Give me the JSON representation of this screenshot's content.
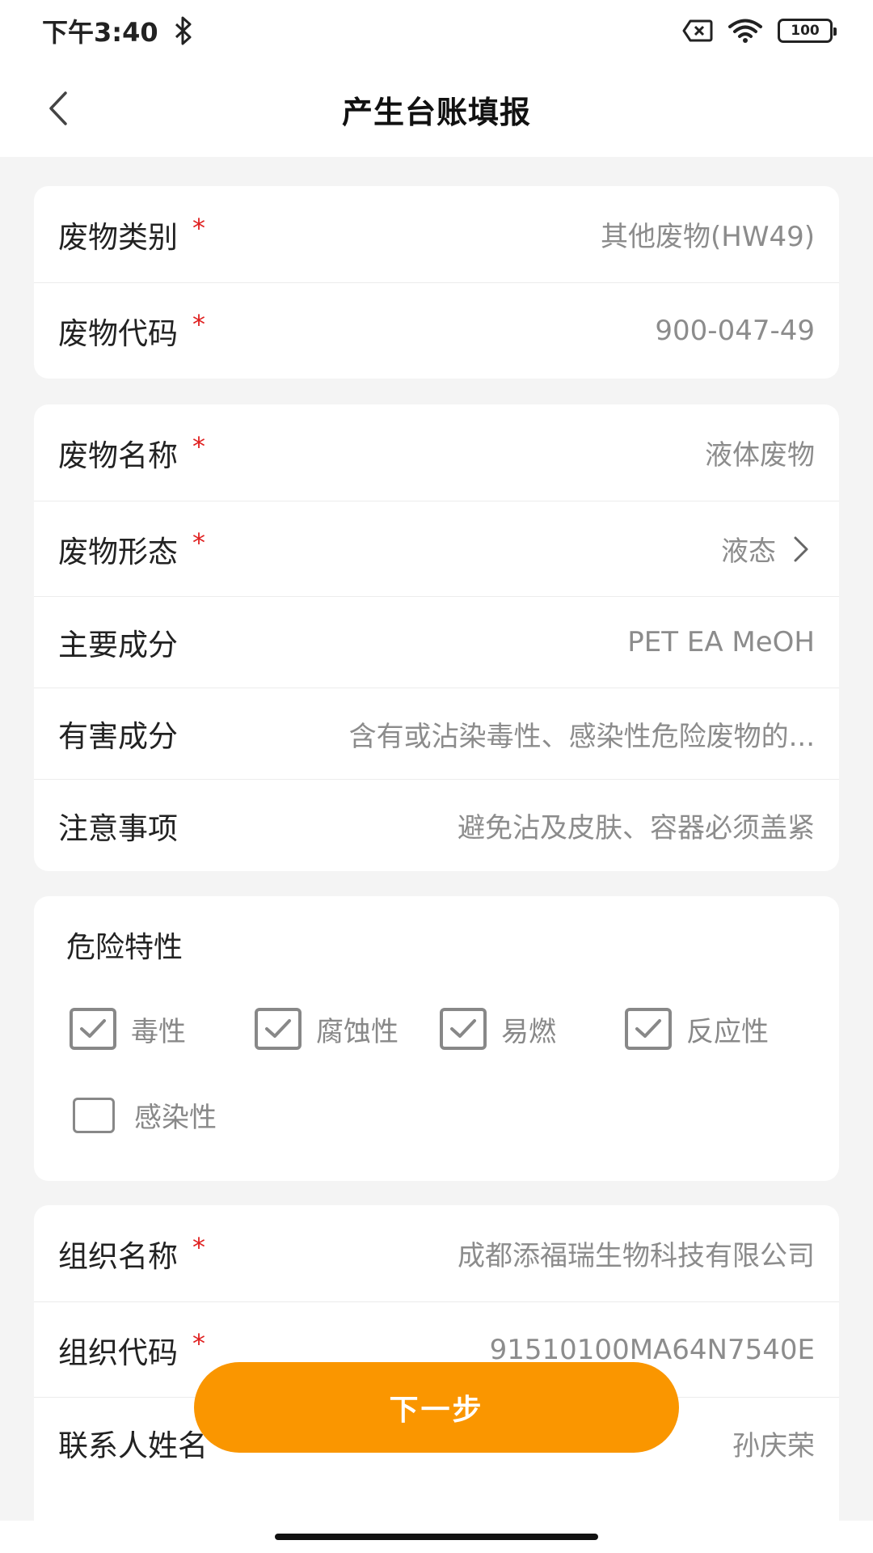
{
  "status_bar": {
    "time": "下午3:40",
    "battery": "100",
    "icons": [
      "bluetooth-icon",
      "sim-off-icon",
      "wifi-icon",
      "battery-icon"
    ]
  },
  "nav": {
    "title": "产生台账填报",
    "back_icon": "chevron-left-icon"
  },
  "section1": {
    "rows": [
      {
        "label": "废物类别",
        "value": "其他废物(HW49)",
        "required": "*"
      },
      {
        "label": "废物代码",
        "value": "900-047-49",
        "required": "*"
      }
    ]
  },
  "section2": {
    "rows": [
      {
        "label": "废物名称",
        "value": "液体废物",
        "required": "*"
      },
      {
        "label": "废物形态",
        "value": "液态",
        "required": "*"
      },
      {
        "label": "主要成分",
        "value": "PET EA MeOH"
      },
      {
        "label": "有害成分",
        "value": "含有或沾染毒性、感染性危险废物的..."
      },
      {
        "label": "注意事项",
        "value": "避免沾及皮肤、容器必须盖紧"
      }
    ]
  },
  "hazard": {
    "title": "危险特性",
    "options": [
      {
        "label": "毒性",
        "checked": true
      },
      {
        "label": "腐蚀性",
        "checked": true
      },
      {
        "label": "易燃",
        "checked": true
      },
      {
        "label": "反应性",
        "checked": true
      },
      {
        "label": "感染性",
        "checked": false
      }
    ]
  },
  "section3": {
    "rows": [
      {
        "label": "组织名称",
        "value": "成都添福瑞生物科技有限公司",
        "required": "*"
      },
      {
        "label": "组织代码",
        "value": "91510100MA64N7540E",
        "required": "*"
      },
      {
        "label": "联系人姓名",
        "value": "孙庆荣"
      }
    ]
  },
  "next_button": {
    "label": "下一步"
  },
  "colors": {
    "accent": "#fa9600",
    "required": "#e02020",
    "value_text": "#8c8c8c",
    "background": "#f4f4f4"
  }
}
